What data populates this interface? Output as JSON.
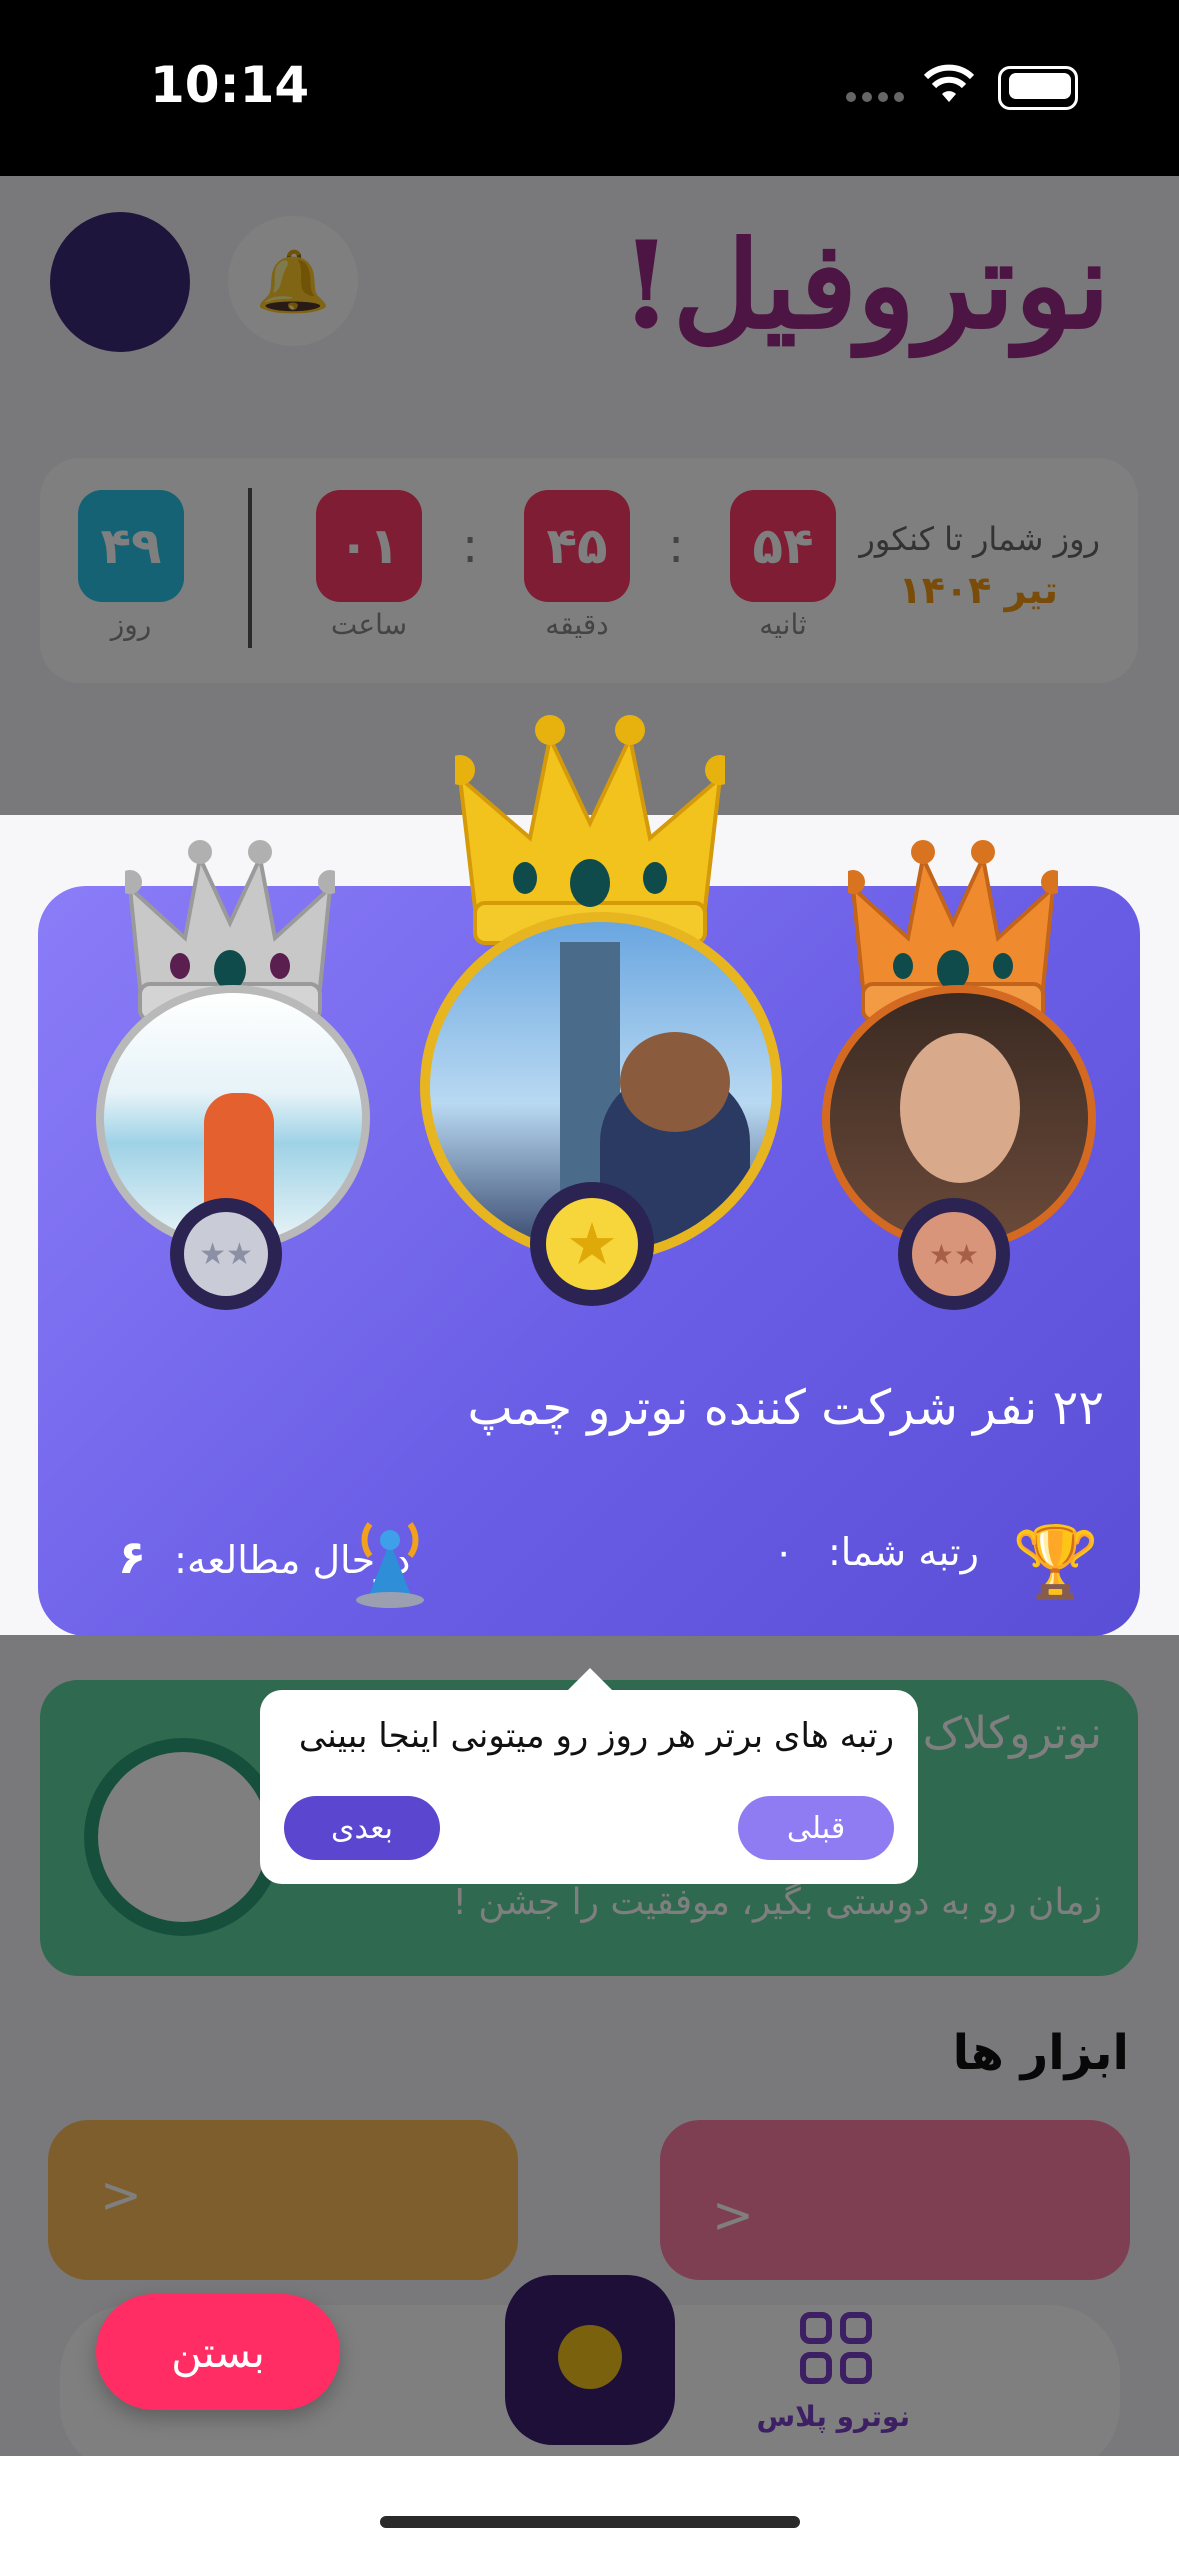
{
  "status_bar": {
    "time": "10:14"
  },
  "app": {
    "logo_text": "نوتروفیل!",
    "countdown": {
      "title": "روز شمار تا کنکور",
      "subtitle": "تیر ۱۴۰۴",
      "seconds_value": "۵۴",
      "seconds_label": "ثانیه",
      "minutes_value": "۴۵",
      "minutes_label": "دقیقه",
      "hours_value": "۰۱",
      "hours_label": "ساعت",
      "days_value": "۴۹",
      "days_label": "روز",
      "separator": ":"
    },
    "green_card": {
      "title": "نوتروکلاک",
      "subtitle": "زمان رو به دوستی بگیر، موفقیت را جشن !"
    },
    "tools_heading": "ابزار ها",
    "tool_arrow": "<",
    "nav_plus_label": "نوترو پلاس"
  },
  "modal": {
    "participants_text": "۲۲ نفر شرکت کننده نوترو چمپ",
    "rank_label": "رتبه شما:",
    "rank_value": "۰",
    "studying_label": "درحال مطالعه:",
    "studying_value": "۶"
  },
  "tooltip": {
    "text": "رتبه های برتر هر روز رو میتونی اینجا ببینی",
    "prev_label": "قبلی",
    "next_label": "بعدی"
  },
  "close_button_label": "بستن",
  "colors": {
    "accent_purple": "#6a5ee6",
    "close_pink": "#ff2d64",
    "gold": "#f2c21d",
    "silver": "#c8c8c8",
    "bronze": "#e07a2c"
  }
}
